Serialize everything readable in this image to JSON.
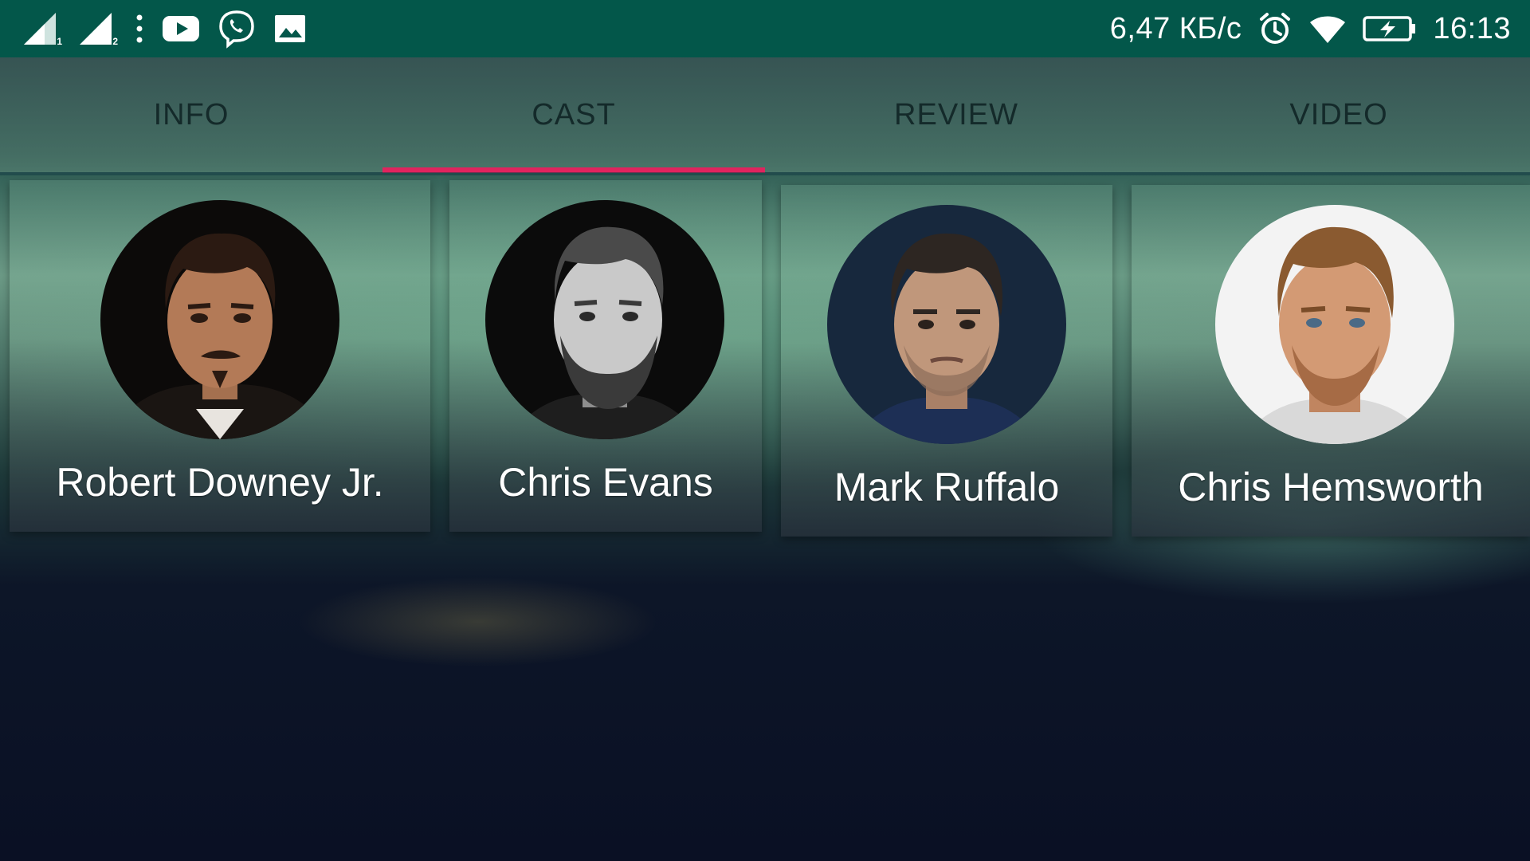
{
  "status_bar": {
    "sim1_label": "1",
    "sim2_label": "2",
    "notifications": [
      "more-dots-icon",
      "youtube-icon",
      "viber-icon",
      "gallery-icon"
    ],
    "network_speed": "6,47 КБ/с",
    "status_icons": [
      "alarm-icon",
      "wifi-icon",
      "battery-charging-icon"
    ],
    "time": "16:13",
    "background_color": "#03574a"
  },
  "tabs": [
    {
      "label": "INFO",
      "active": false
    },
    {
      "label": "CAST",
      "active": true
    },
    {
      "label": "REVIEW",
      "active": false
    },
    {
      "label": "VIDEO",
      "active": false
    }
  ],
  "accent_color": "#e0245e",
  "cast": [
    {
      "name": "Robert Downey Jr.",
      "photo": "robert-downey-jr-photo"
    },
    {
      "name": "Chris Evans",
      "photo": "chris-evans-photo"
    },
    {
      "name": "Mark Ruffalo",
      "photo": "mark-ruffalo-photo"
    },
    {
      "name": "Chris Hemsworth",
      "photo": "chris-hemsworth-photo"
    }
  ]
}
